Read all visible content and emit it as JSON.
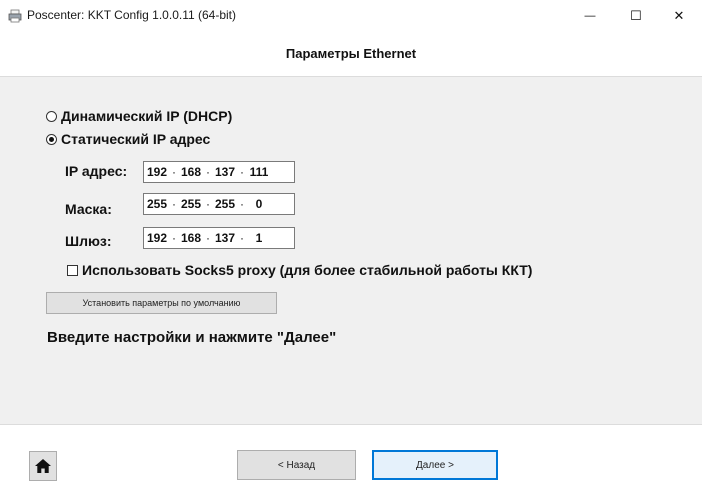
{
  "window": {
    "title": "Poscenter: KKT Config 1.0.0.11 (64-bit)",
    "minimize_symbol": "—",
    "maximize_symbol": "☐",
    "close_symbol": "✕"
  },
  "header": {
    "title": "Параметры Ethernet"
  },
  "ip_mode": {
    "options": [
      {
        "label": "Динамический IP (DHCP)",
        "selected": false
      },
      {
        "label": "Статический IP адрес",
        "selected": true
      }
    ]
  },
  "network": {
    "ip": {
      "label": "IP адрес:",
      "octets": [
        "192",
        "168",
        "137",
        "111"
      ]
    },
    "mask": {
      "label": "Маска:",
      "octets": [
        "255",
        "255",
        "255",
        "0"
      ]
    },
    "gateway": {
      "label": "Шлюз:",
      "octets": [
        "192",
        "168",
        "137",
        "1"
      ]
    },
    "separator": "·"
  },
  "proxy": {
    "label": "Использовать Socks5 proxy (для более стабильной работы ККТ)",
    "checked": false
  },
  "default_button": {
    "label": "Установить параметры по умолчанию"
  },
  "hint": {
    "text": "Введите настройки и нажмите \"Далее\""
  },
  "footer": {
    "home_icon": "home-icon",
    "back_label": "< Назад",
    "next_label": "Далее >",
    "accent_color": "#0078d7"
  }
}
